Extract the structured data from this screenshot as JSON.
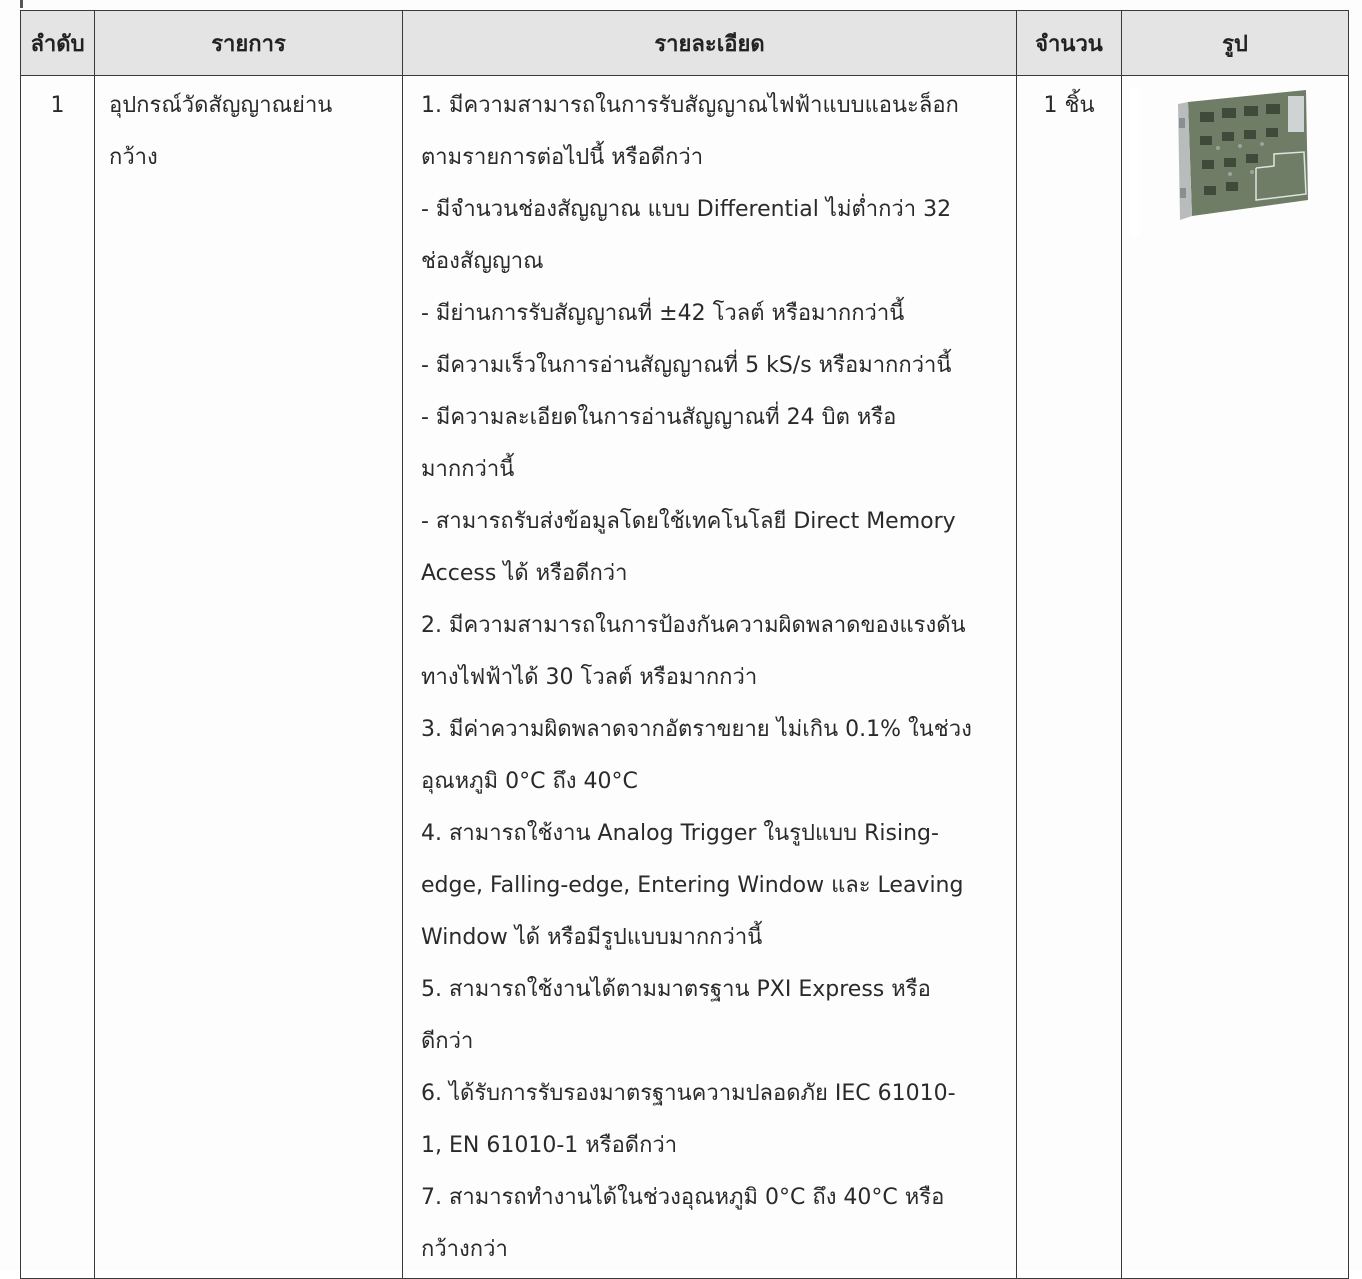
{
  "table": {
    "headers": {
      "no": "ลำดับ",
      "item": "รายการ",
      "detail": "รายละเอียด",
      "qty": "จำนวน",
      "image": "รูป"
    },
    "rows": [
      {
        "no": "1",
        "item_lines": [
          "อุปกรณ์วัดสัญญาณย่าน",
          "กว้าง"
        ],
        "detail_lines": [
          "1. มีความสามารถในการรับสัญญาณไฟฟ้าแบบแอนะล็อก",
          "ตามรายการต่อไปนี้ หรือดีกว่า",
          "- มีจำนวนช่องสัญญาณ แบบ Differential ไม่ต่ำกว่า 32",
          "ช่องสัญญาณ",
          "- มีย่านการรับสัญญาณที่ ±42 โวลต์ หรือมากกว่านี้",
          "- มีความเร็วในการอ่านสัญญาณที่ 5 kS/s หรือมากกว่านี้",
          "- มีความละเอียดในการอ่านสัญญาณที่ 24 บิต หรือ",
          "มากกว่านี้",
          "- สามารถรับส่งข้อมูลโดยใช้เทคโนโลยี Direct Memory",
          "Access ได้ หรือดีกว่า",
          "2. มีความสามารถในการป้องกันความผิดพลาดของแรงดัน",
          "ทางไฟฟ้าได้ 30 โวลต์ หรือมากกว่า",
          "3. มีค่าความผิดพลาดจากอัตราขยาย ไม่เกิน 0.1% ในช่วง",
          "อุณหภูมิ 0°C ถึง 40°C",
          "4. สามารถใช้งาน Analog Trigger ในรูปแบบ Rising-",
          "edge, Falling-edge, Entering Window และ Leaving",
          "Window ได้ หรือมีรูปแบบมากกว่านี้",
          "5. สามารถใช้งานได้ตามมาตรฐาน PXI Express หรือ",
          "ดีกว่า",
          "6. ได้รับการรับรองมาตรฐานความปลอดภัย IEC 61010-",
          "1, EN 61010-1 หรือดีกว่า",
          "7. สามารถทำงานได้ในช่วงอุณหภูมิ 0°C ถึง 40°C หรือ",
          "กว้างกว่า"
        ],
        "qty": "1 ชิ้น",
        "image_icon": "pxi-card-icon"
      }
    ]
  },
  "colors": {
    "header_bg": "#e4e4e4",
    "border": "#3a3a3a",
    "text": "#2a2a2a",
    "board_green": "#6f7d67"
  }
}
